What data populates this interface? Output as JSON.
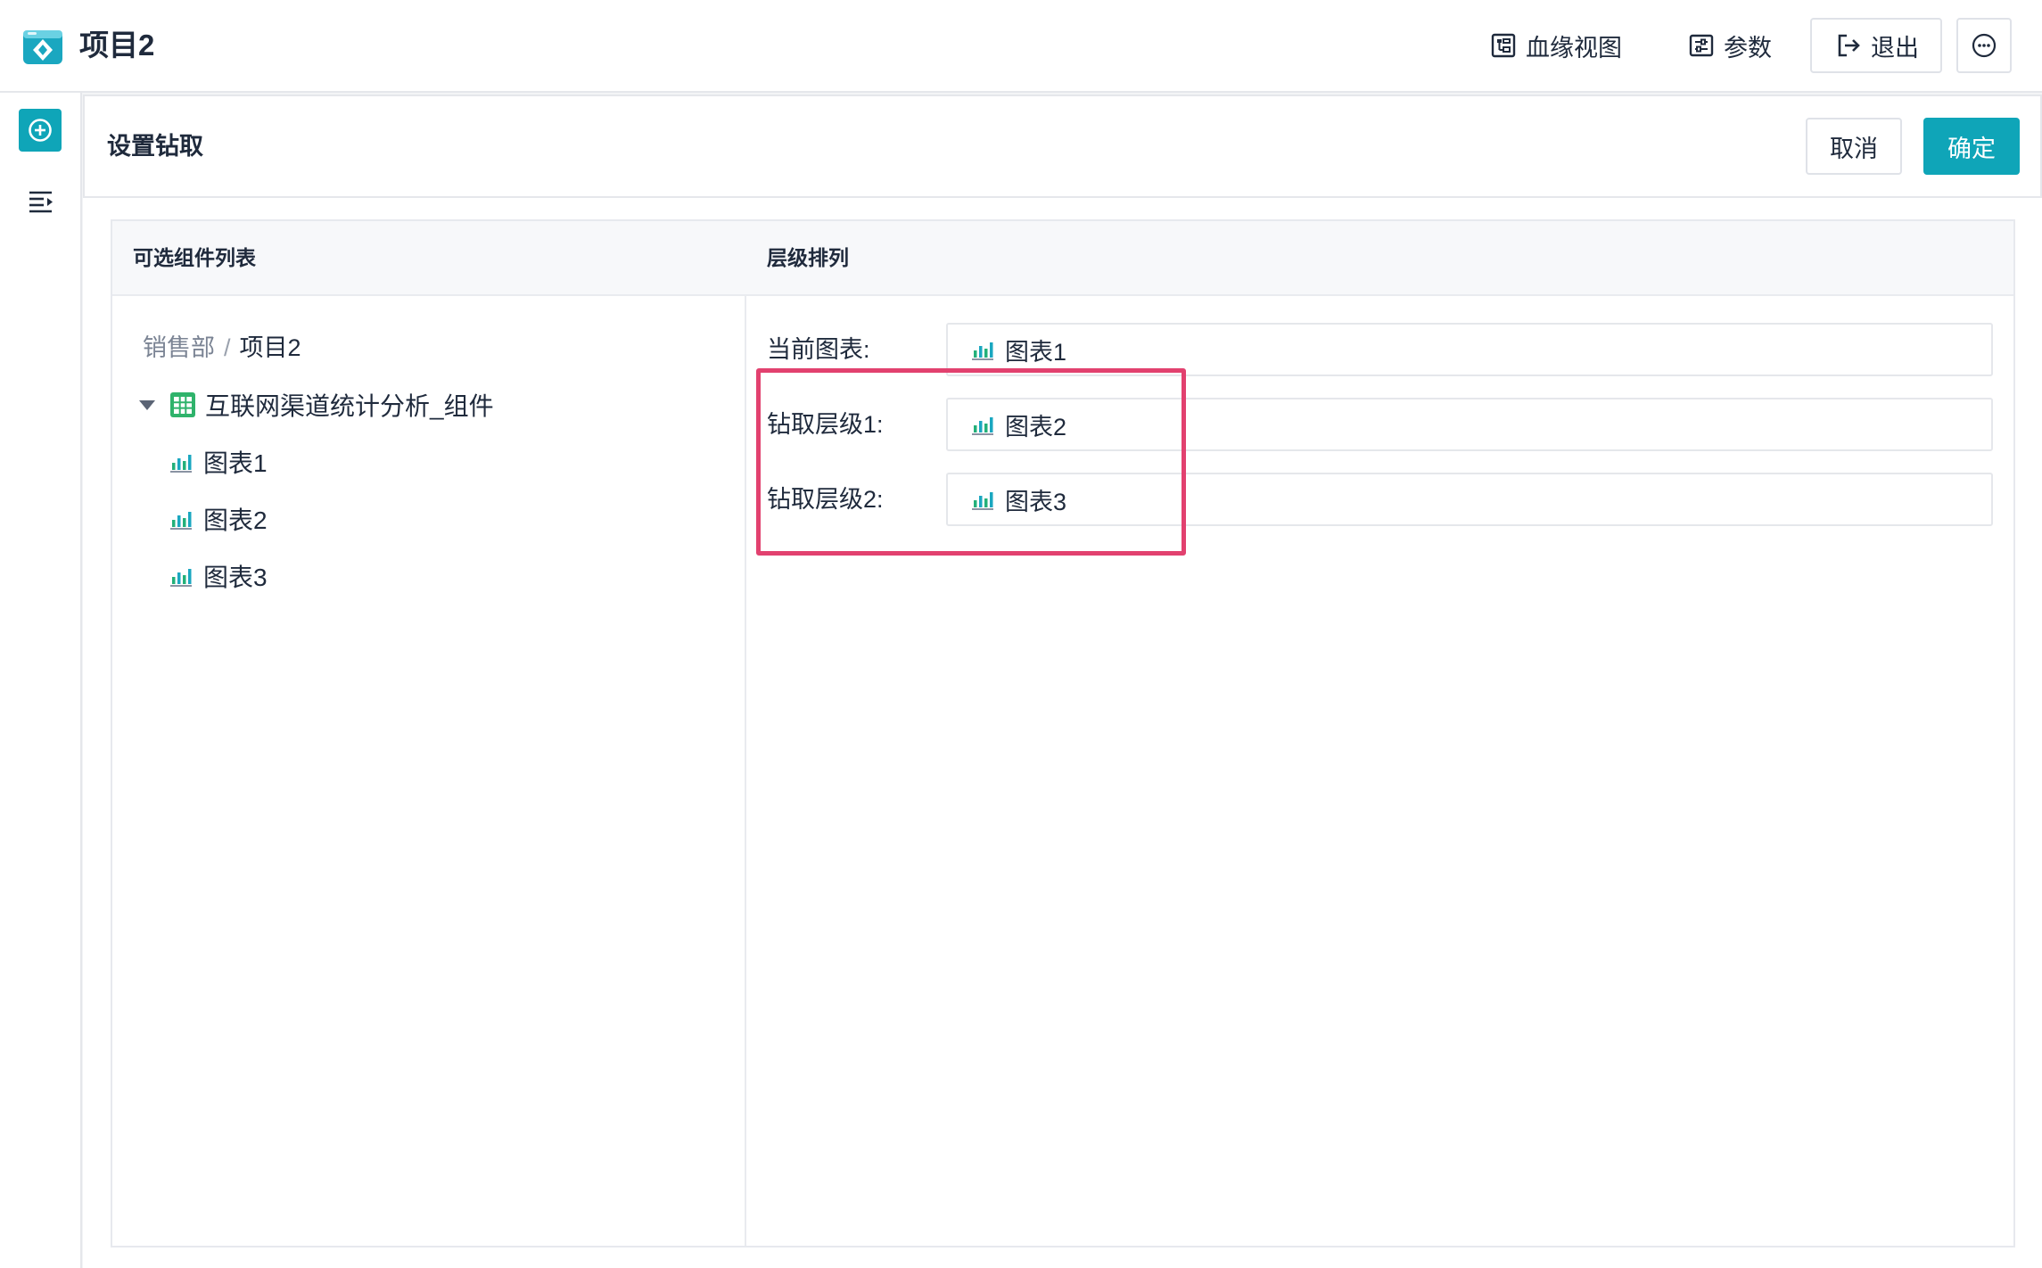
{
  "app": {
    "title": "项目2"
  },
  "topbar": {
    "lineage_label": "血缘视图",
    "params_label": "参数",
    "exit_label": "退出",
    "more_icon": "ellipsis-circle-icon"
  },
  "rail": {
    "add_icon": "plus-circle-icon",
    "outline_icon": "outline-list-icon"
  },
  "drill": {
    "title": "设置钻取",
    "cancel_label": "取消",
    "ok_label": "确定",
    "left_header": "可选组件列表",
    "right_header": "层级排列",
    "breadcrumb": {
      "parent": "销售部",
      "separator": "/",
      "current": "项目2"
    },
    "folder": {
      "label": "互联网渠道统计分析_组件",
      "expanded": true
    },
    "components": [
      {
        "label": "图表1"
      },
      {
        "label": "图表2"
      },
      {
        "label": "图表3"
      }
    ],
    "levels": [
      {
        "label": "当前图表:",
        "value": "图表1"
      },
      {
        "label": "钻取层级1:",
        "value": "图表2"
      },
      {
        "label": "钻取层级2:",
        "value": "图表3"
      }
    ]
  },
  "colors": {
    "accent": "#0fa5b8",
    "highlight": "#e2416f",
    "chart_icon": "#23b07a"
  }
}
